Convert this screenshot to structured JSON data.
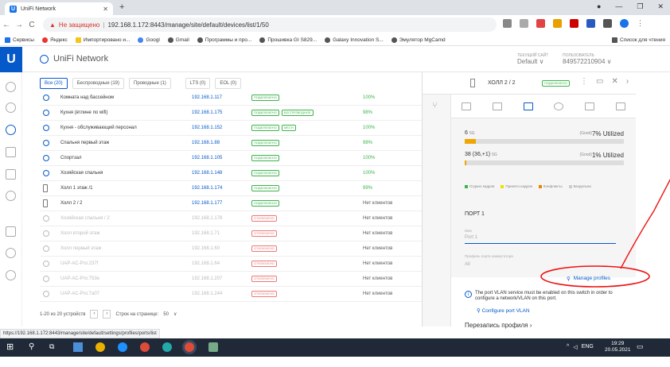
{
  "browser": {
    "tab_title": "UniFi Network",
    "url_warning": "Не защищено",
    "url": "192.168.1.172:8443/manage/site/default/devices/list/1/50",
    "bookmarks": [
      "Сервисы",
      "Яндекс",
      "Импортировано и...",
      "Googl",
      "Gmail",
      "Программы и про...",
      "Прошивка GI S829...",
      "Galaxy Innovation S...",
      "Эмулятор MgCamd"
    ],
    "reading_list": "Список для чтения",
    "status_url": "https://192.168.1.172:8443/manage/site/default/settings/profiles/ports/list"
  },
  "header": {
    "app_name": "UniFi Network",
    "site_label": "ТЕКУЩИЙ САЙТ",
    "site_value": "Default",
    "admin_label": "ПОЛЬЗОВАТЕЛЬ",
    "admin_value": "849572210904"
  },
  "filters": [
    "Все (20)",
    "Беспроводные (19)",
    "Проводные (1)",
    "LTS (0)",
    "EOL (0)"
  ],
  "devices": [
    {
      "name": "Комната над бассейном",
      "ip": "192.168.1.117",
      "badges": [
        "ПОДКЛЮЧЕНО"
      ],
      "signal": "100%",
      "type": "ap",
      "off": false
    },
    {
      "name": "Кухня (втлине по wifi)",
      "ip": "192.168.1.175",
      "badges": [
        "ПОДКЛЮЧЕНО",
        "БЕСПРОВОДНОЕ"
      ],
      "signal": "98%",
      "type": "ap",
      "off": false
    },
    {
      "name": "Кухня - обслуживающий персонал",
      "ip": "192.168.1.152",
      "badges": [
        "ПОДКЛЮЧЕНО",
        "МЕСН"
      ],
      "signal": "100%",
      "type": "ap",
      "off": false
    },
    {
      "name": "Спальня первый этаж",
      "ip": "192.168.1.88",
      "badges": [
        "ПОДКЛЮЧЕНО"
      ],
      "signal": "98%",
      "type": "ap",
      "off": false
    },
    {
      "name": "Спортзал",
      "ip": "192.168.1.105",
      "badges": [
        "ПОДКЛЮЧЕНО"
      ],
      "signal": "100%",
      "type": "ap",
      "off": false
    },
    {
      "name": "Хозяйская спальня",
      "ip": "192.168.1.148",
      "badges": [
        "ПОДКЛЮЧЕНО"
      ],
      "signal": "100%",
      "type": "ap",
      "off": false
    },
    {
      "name": "Холл 1 этаж /1",
      "ip": "192.168.1.174",
      "badges": [
        "ПОДКЛЮЧЕНО"
      ],
      "signal": "99%",
      "type": "sw",
      "off": false
    },
    {
      "name": "Холл 2 / 2",
      "ip": "192.168.1.177",
      "badges": [
        "ПОДКЛЮЧЕНО"
      ],
      "signal": "Нет клиентов",
      "type": "sw",
      "off": false
    },
    {
      "name": "Хозяйская спальня / 2",
      "ip": "192.168.1.178",
      "badges": [
        "ОТКЛЮЧЕНО"
      ],
      "signal": "Нет клиентов",
      "type": "ap",
      "off": true
    },
    {
      "name": "Холл второй этаж",
      "ip": "192.168.1.71",
      "badges": [
        "ОТКЛЮЧЕНО"
      ],
      "signal": "Нет клиентов",
      "type": "ap",
      "off": true
    },
    {
      "name": "Холл первый этаж",
      "ip": "192.168.1.60",
      "badges": [
        "ОТКЛЮЧЕНО"
      ],
      "signal": "Нет клиентов",
      "type": "ap",
      "off": true
    },
    {
      "name": "UAP-AC-Pro:237f",
      "ip": "192.168.1.64",
      "badges": [
        "ОТКЛЮЧЕНО"
      ],
      "signal": "Нет клиентов",
      "type": "ap",
      "off": true
    },
    {
      "name": "UAP-AC-Pro:753e",
      "ip": "192.168.1.207",
      "badges": [
        "ОТКЛЮЧЕНО"
      ],
      "signal": "Нет клиентов",
      "type": "ap",
      "off": true
    },
    {
      "name": "UAP-AC-Pro:7a07",
      "ip": "192.168.1.244",
      "badges": [
        "ОТКЛЮЧЕНО"
      ],
      "signal": "Нет клиентов",
      "type": "ap",
      "off": true
    }
  ],
  "pager": {
    "range": "1-20 из 20 устройств",
    "rows_label": "Строк на странице:",
    "rows_value": "50"
  },
  "panel": {
    "title": "ХОЛЛ 2 / 2",
    "status": "ПОДКЛЮЧЕНО",
    "bands": [
      {
        "label": "6",
        "unit": "5G",
        "quality": "(Good)",
        "util": "7% Utilized",
        "fill": 0.07
      },
      {
        "label": "38 (36,+1)",
        "unit": "5G",
        "quality": "(Good)",
        "util": "1% Utilized",
        "fill": 0.01
      }
    ],
    "legend": [
      {
        "label": "Отдано кадров",
        "color": "#3cb44b"
      },
      {
        "label": "Принято кадров",
        "color": "#f0e000"
      },
      {
        "label": "Конфликты",
        "color": "#f08000"
      },
      {
        "label": "Бездельни",
        "color": "#cccccc"
      }
    ],
    "port_title": "ПОРТ 1",
    "name_label": "Имя",
    "name_value": "Port 1",
    "profile_label": "Профиль порта коммутатора",
    "profile_value": "All",
    "manage_profiles": "Manage profiles",
    "vlan_note": "The port VLAN service must be enabled on this switch in order to configure a network/VLAN on this port.",
    "configure_vlan": "Configure port VLAN",
    "override": "Перезапись профиля"
  },
  "taskbar": {
    "lang": "ENG",
    "time": "19:29",
    "date": "20.05.2021"
  }
}
